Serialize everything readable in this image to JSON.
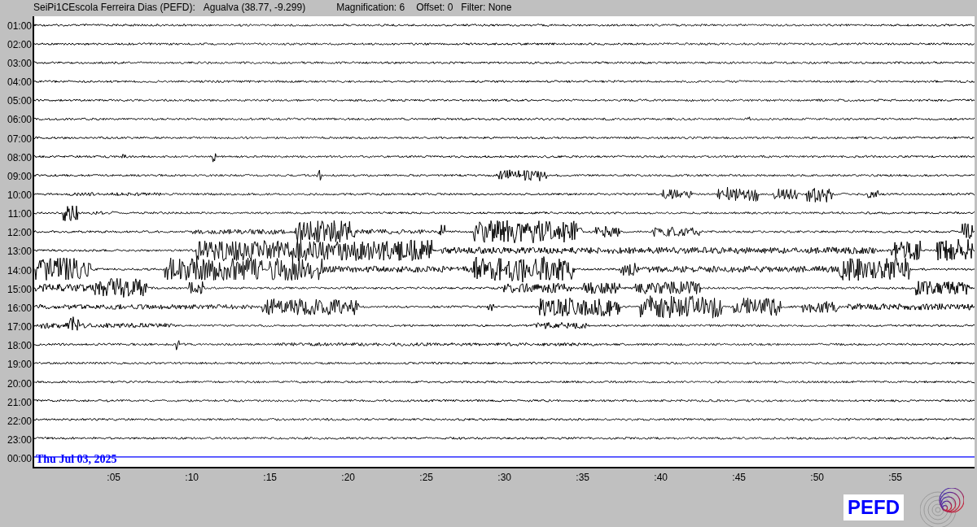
{
  "header": {
    "station": "SeiPi1CEscola Ferreira Dias (PEFD):",
    "location": "Agualva (38.77, -9.299)",
    "magnification": "Magnification: 6",
    "offset": "Offset: 0",
    "filter": "Filter: None"
  },
  "rows": [
    {
      "label": "01:00",
      "kind": "trace"
    },
    {
      "label": "02:00",
      "kind": "trace"
    },
    {
      "label": "03:00",
      "kind": "trace"
    },
    {
      "label": "04:00",
      "kind": "trace"
    },
    {
      "label": "05:00",
      "kind": "trace"
    },
    {
      "label": "06:00",
      "kind": "trace"
    },
    {
      "label": "07:00",
      "kind": "trace"
    },
    {
      "label": "08:00",
      "kind": "trace"
    },
    {
      "label": "09:00",
      "kind": "trace"
    },
    {
      "label": "10:00",
      "kind": "trace"
    },
    {
      "label": "11:00",
      "kind": "trace"
    },
    {
      "label": "12:00",
      "kind": "trace"
    },
    {
      "label": "13:00",
      "kind": "trace"
    },
    {
      "label": "14:00",
      "kind": "trace"
    },
    {
      "label": "15:00",
      "kind": "trace"
    },
    {
      "label": "16:00",
      "kind": "trace"
    },
    {
      "label": "17:00",
      "kind": "trace"
    },
    {
      "label": "18:00",
      "kind": "trace"
    },
    {
      "label": "19:00",
      "kind": "trace"
    },
    {
      "label": "20:00",
      "kind": "trace"
    },
    {
      "label": "21:00",
      "kind": "trace"
    },
    {
      "label": "22:00",
      "kind": "trace"
    },
    {
      "label": "23:00",
      "kind": "trace"
    },
    {
      "label": "00:00",
      "kind": "current"
    }
  ],
  "date": "Thu Jul 03, 2025",
  "x_ticks": [
    ":05",
    ":10",
    ":15",
    ":20",
    ":25",
    ":30",
    ":35",
    ":40",
    ":45",
    ":50",
    ":55"
  ],
  "badge": "PEFD"
}
